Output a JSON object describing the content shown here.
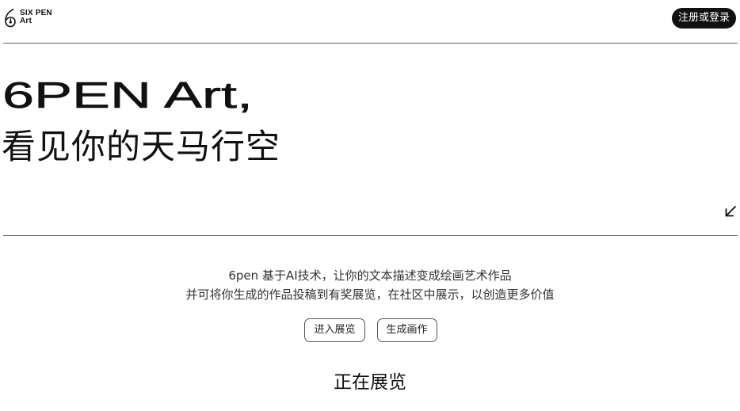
{
  "header": {
    "logo_line1": "SIX PEN",
    "logo_line2": "Art",
    "auth_label": "注册或登录"
  },
  "hero": {
    "title": "6PEN Art,",
    "subtitle": "看见你的天马行空"
  },
  "description": {
    "line1": "6pen 基于AI技术，让你的文本描述变成绘画艺术作品",
    "line2": "并可将你生成的作品投稿到有奖展览，在社区中展示，以创造更多价值"
  },
  "actions": {
    "enter_exhibition": "进入展览",
    "generate_artwork": "生成画作"
  },
  "section": {
    "title": "正在展览"
  },
  "icons": {
    "logo": "six-pen-logo-icon",
    "arrow": "arrow-down-left-icon"
  },
  "colors": {
    "text": "#111111",
    "background": "#ffffff",
    "button_dark": "#111111",
    "rule": "#666666"
  }
}
